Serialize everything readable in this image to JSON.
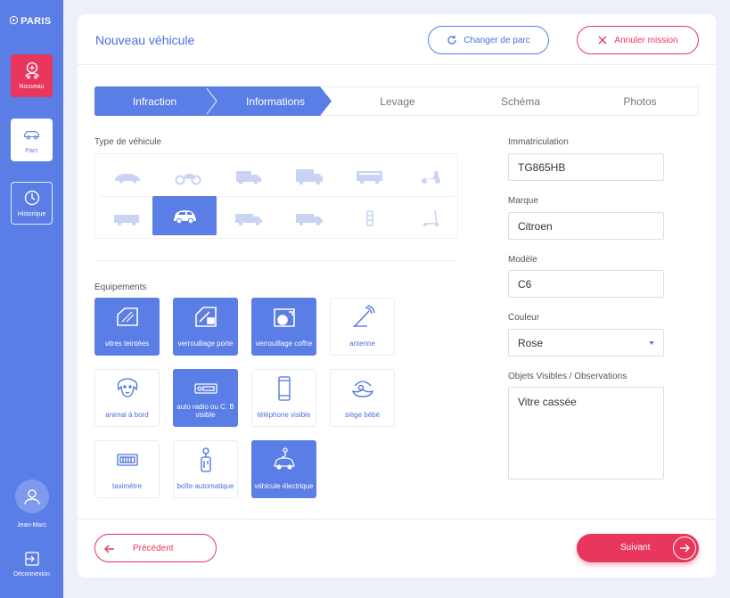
{
  "colors": {
    "primary": "#5b7de6",
    "accent": "#e8365d",
    "background": "#eef0f7"
  },
  "sidebar": {
    "logo": "PARIS",
    "items": [
      {
        "label": "Nouveau",
        "icon": "add-car-icon",
        "active": true
      },
      {
        "label": "Parc",
        "icon": "car-icon",
        "active": false
      },
      {
        "label": "Historique",
        "icon": "history-icon",
        "active": false
      }
    ],
    "user_name": "Jean-Marc",
    "logout_label": "Déconnexion"
  },
  "header": {
    "title": "Nouveau véhicule",
    "change_parc": "Changer de parc",
    "cancel_mission": "Annuler mission"
  },
  "steps": [
    {
      "label": "Infraction",
      "state": "done"
    },
    {
      "label": "Informations",
      "state": "active"
    },
    {
      "label": "Levage",
      "state": "todo"
    },
    {
      "label": "Schéma",
      "state": "todo"
    },
    {
      "label": "Photos",
      "state": "todo"
    }
  ],
  "vehicle_type": {
    "label": "Type de véhicule",
    "icons": [
      "car-icon",
      "motorcycle-icon",
      "van-icon",
      "truck-icon",
      "bus-icon",
      "scooter-icon",
      "trailer-icon",
      "small-car-icon",
      "tonnage-truck-icon",
      "tonnage-truck-icon",
      "bollard-icon",
      "kick-scooter-icon"
    ],
    "selected": "small-car-icon"
  },
  "equipements": {
    "label": "Equipements",
    "items": [
      {
        "label": "vitres teintées",
        "icon": "tinted-window-icon",
        "selected": true
      },
      {
        "label": "verrouillage porte",
        "icon": "door-lock-icon",
        "selected": true
      },
      {
        "label": "verrouillage coffre",
        "icon": "trunk-lock-icon",
        "selected": true
      },
      {
        "label": "antenne",
        "icon": "antenna-icon",
        "selected": false
      },
      {
        "label": "animal à bord",
        "icon": "dog-icon",
        "selected": false
      },
      {
        "label": "auto radio ou C. B visible",
        "icon": "radio-icon",
        "selected": true
      },
      {
        "label": "téléphone visible",
        "icon": "phone-icon",
        "selected": false
      },
      {
        "label": "siège bébé",
        "icon": "baby-seat-icon",
        "selected": false
      },
      {
        "label": "taximètre",
        "icon": "taximeter-icon",
        "selected": false
      },
      {
        "label": "boîte automatique",
        "icon": "gearbox-icon",
        "selected": false
      },
      {
        "label": "véhicule électrique",
        "icon": "electric-car-icon",
        "selected": true
      }
    ]
  },
  "form": {
    "immatriculation": {
      "label": "Immatriculation",
      "value": "TG865HB"
    },
    "marque": {
      "label": "Marque",
      "value": "Citroen"
    },
    "modele": {
      "label": "Modèle",
      "value": "C6"
    },
    "couleur": {
      "label": "Couleur",
      "value": "Rose"
    },
    "observations": {
      "label": "Objets Visibles / Observations",
      "value": "Vitre cassée"
    }
  },
  "footer": {
    "prev": "Précédent",
    "next": "Suivant"
  }
}
